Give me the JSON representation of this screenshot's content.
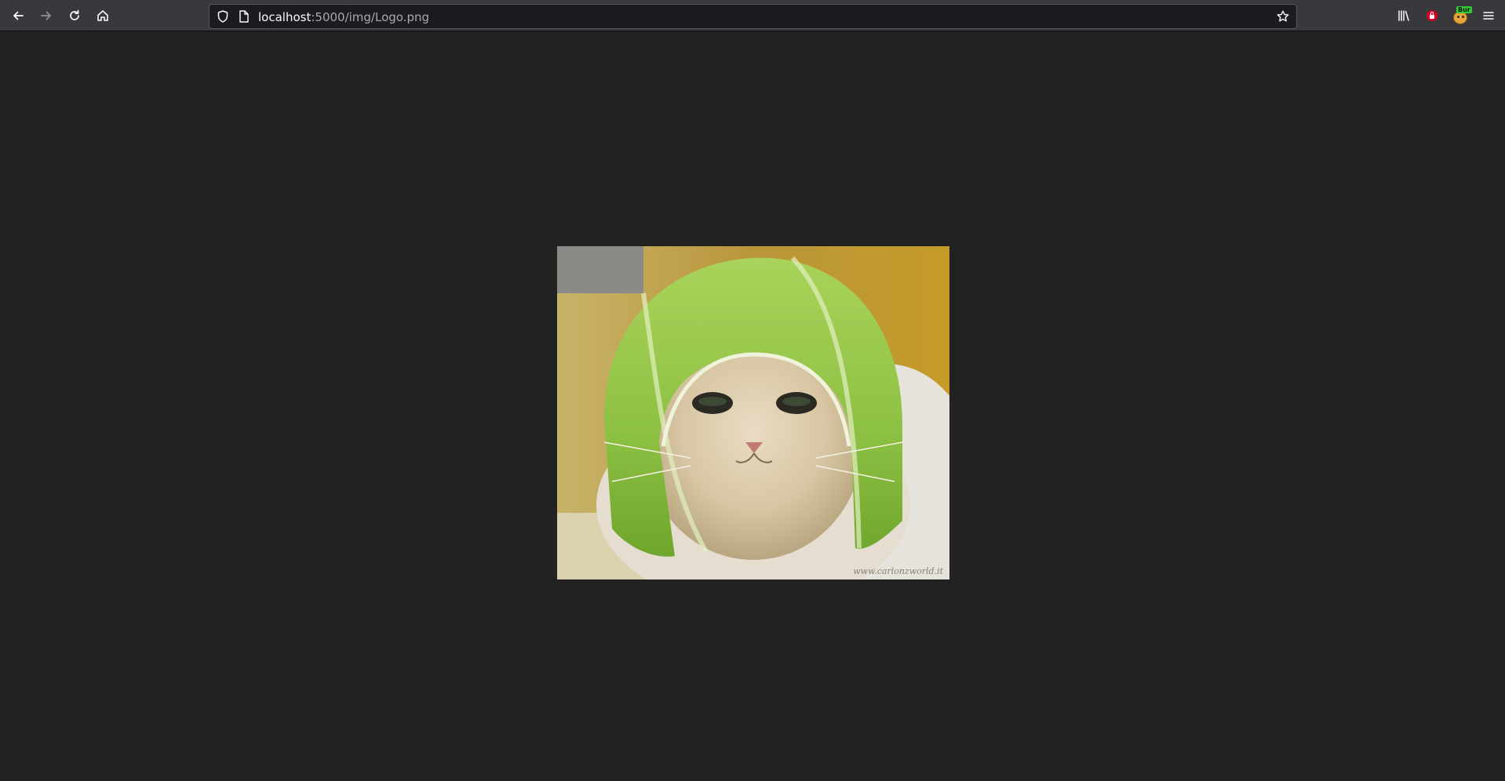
{
  "browser": {
    "url_host": "localhost",
    "url_rest": ":5000/img/Logo.png",
    "toolbar_icons": [
      "back-icon",
      "forward-icon",
      "reload-icon",
      "home-icon",
      "shield-icon",
      "page-icon",
      "bookmark-star-icon",
      "library-icon",
      "lock-extension-icon",
      "extension-icon",
      "menu-icon"
    ],
    "extension_badge": "Bur"
  },
  "colors": {
    "page_background": "#222222",
    "toolbar_background": "#38383d",
    "urlbar_background": "#1c1b22",
    "lock_badge": "#d70022",
    "extension_badge": "#33cc33"
  },
  "image": {
    "subject": "cat wearing a green citrus-peel helmet",
    "watermark": "www.carlonzworld.it"
  }
}
